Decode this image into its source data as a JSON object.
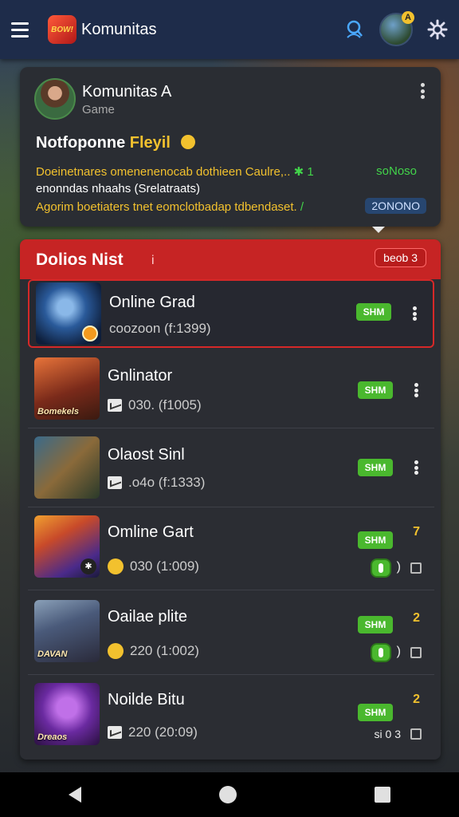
{
  "appbar": {
    "logo_text": "BOW!",
    "title": "Komunitas",
    "avatar_badge": "A",
    "icons": [
      "menu-icon",
      "profile-search-icon",
      "gear-icon"
    ]
  },
  "community": {
    "name": "Komunitas A",
    "subtitle": "Game",
    "heading_prefix": "Notfoponne",
    "heading_highlight": "Fleyil",
    "line1": "Doeinetnares omenenenocab dothieen Caulre,..",
    "line1_mark": "✱",
    "line1_num": "1",
    "line1_stat": "soNoso",
    "line2": "enonndas nhaahs (Srelatraats)",
    "line3": "Agorim boetiaters tnet eomclotbadap tdbendaset.",
    "line3_mark": "/",
    "line3_stat": "2ONONO"
  },
  "list": {
    "header_title": "Dolios Nist",
    "header_pin": "i",
    "header_badge": "beob 3",
    "games": [
      {
        "title": "Online Grad",
        "meta": "coozoon (f:1399)",
        "meta_icon": "none",
        "pill": "SHM",
        "trailing": "more",
        "thumb_tag": "",
        "thumb_badge": "coin"
      },
      {
        "title": "Gnlinator",
        "meta": "030. (f1005)",
        "meta_icon": "mail-icon",
        "pill": "SHM",
        "trailing": "more",
        "thumb_tag": "Bomekels",
        "thumb_badge": ""
      },
      {
        "title": "Olaost Sinl",
        "meta": ".o4o (f:1333)",
        "meta_icon": "mail-icon",
        "pill": "SHM",
        "trailing": "more",
        "thumb_tag": "",
        "thumb_badge": ""
      },
      {
        "title": "Omline Gart",
        "meta": "030 (1:009)",
        "meta_icon": "smile-icon",
        "pill": "SHM",
        "trailing": "rank",
        "rank": "7",
        "paren": ")",
        "thumb_tag": "",
        "thumb_badge": "paw"
      },
      {
        "title": "Oailae plite",
        "meta": "220 (1:002)",
        "meta_icon": "smile-icon",
        "pill": "SHM",
        "trailing": "rank",
        "rank": "2",
        "paren": ")",
        "thumb_tag": "DAVAN",
        "thumb_badge": ""
      },
      {
        "title": "Noilde Bitu",
        "meta": "220 (20:09)",
        "meta_icon": "mail-icon",
        "pill": "SHM",
        "trailing": "rank",
        "rank": "2",
        "extra": "si 0 3",
        "thumb_tag": "Dreaos",
        "thumb_badge": ""
      }
    ]
  },
  "colors": {
    "appbar": "#1e2c4a",
    "header_red": "#c62424",
    "accent_yellow": "#f2c12e",
    "accent_green": "#42d44a",
    "pill_green": "#4ab82e"
  }
}
